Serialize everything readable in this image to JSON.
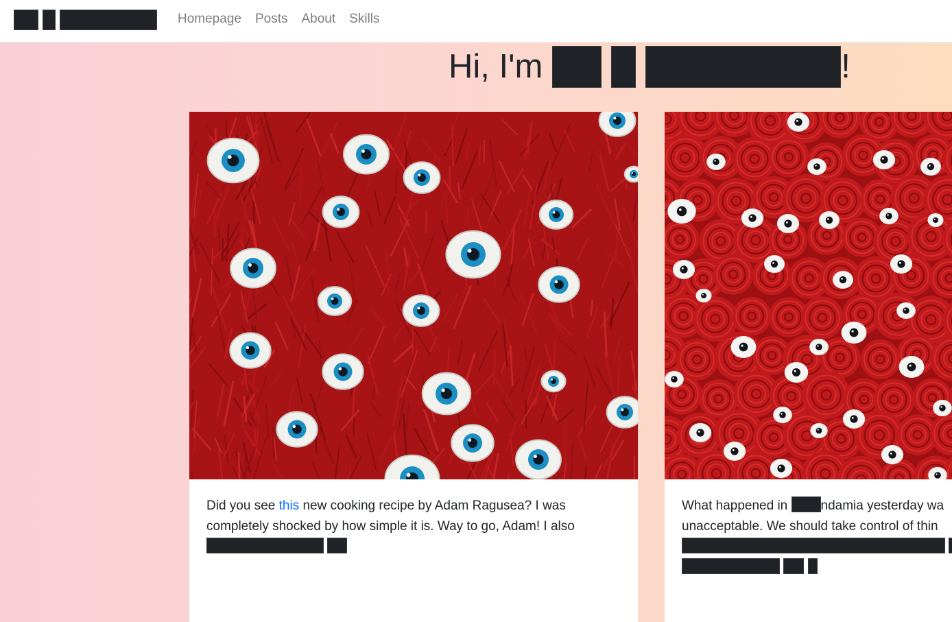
{
  "navbar": {
    "links": [
      "Homepage",
      "Posts",
      "About",
      "Skills"
    ]
  },
  "hero": {
    "prefix": "Hi, I'm",
    "suffix": "!"
  },
  "cards": [
    {
      "image_alt": "red yarn with blue eyes",
      "text_before_link": "Did you see ",
      "link_text": "this",
      "text_after_link": " new cooking recipe by Adam Ragusea? I was completely shocked by how simple it is. Way to go, Adam! I also"
    },
    {
      "image_alt": "red yarn balls with eyes",
      "line1_before": "What happened in ",
      "line1_after": "ndamia yesterday wa",
      "line2": "unacceptable. We should take control of thin"
    }
  ],
  "colors": {
    "link": "#0d6efd",
    "text": "#212529",
    "nav_text": "#7d7d7d",
    "redaction": "#1f2227"
  }
}
